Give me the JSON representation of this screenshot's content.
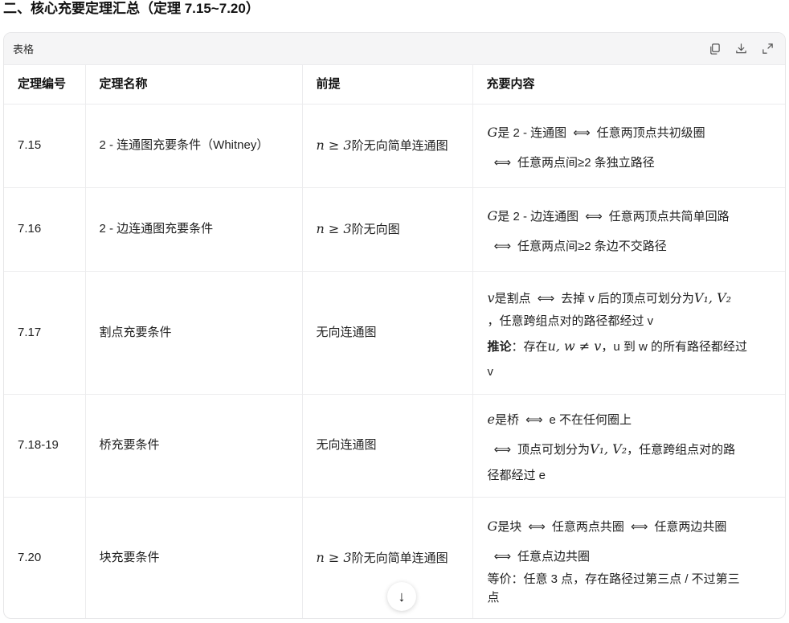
{
  "section_title": "二、核心充要定理汇总（定理 7.15~7.20）",
  "card": {
    "label": "表格",
    "tools": [
      "copy-icon",
      "download-icon",
      "expand-icon"
    ]
  },
  "table": {
    "headers": [
      "定理编号",
      "定理名称",
      "前提",
      "充要内容"
    ],
    "rows": [
      {
        "num": "7.15",
        "name": "2 - 连通图充要条件（Whitney）",
        "premise_math": "n ≥ 3",
        "premise_text": "阶无向简单连通图",
        "c1_math": "G",
        "c1_a": "是 2 - 连通图",
        "c1_b": "任意两顶点共初级圈",
        "c2": "任意两点间≥2 条独立路径"
      },
      {
        "num": "7.16",
        "name": "2 - 边连通图充要条件",
        "premise_math": "n ≥ 3",
        "premise_text": "阶无向图",
        "c1_math": "G",
        "c1_a": "是 2 - 边连通图",
        "c1_b": "任意两顶点共简单回路",
        "c2": "任意两点间≥2 条边不交路径"
      },
      {
        "num": "7.17",
        "name": "割点充要条件",
        "premise_text": "无向连通图",
        "c1_math": "v",
        "c1_a": "是割点",
        "c1_b": "去掉 v 后的顶点可划分为",
        "c1_math2": "V₁, V₂",
        "c2": "，任意跨组点对的路径都经过 v",
        "c3_bold": "推论",
        "c3_a": "：存在",
        "c3_math": "u, w ≠ v",
        "c3_b": "，u 到 w 的所有路径都经过",
        "c3_c": "v"
      },
      {
        "num": "7.18-19",
        "name": "桥充要条件",
        "premise_text": "无向连通图",
        "c1_math": "e",
        "c1_a": "是桥",
        "c1_b": "e 不在任何圈上",
        "c2_a": "顶点可划分为",
        "c2_math": "V₁, V₂",
        "c2_b": "，任意跨组点对的路",
        "c2_c": "径都经过 e"
      },
      {
        "num": "7.20",
        "name": "块充要条件",
        "premise_math": "n ≥ 3",
        "premise_text": "阶无向简单连通图",
        "c1_math": "G",
        "c1_a": "是块",
        "c1_b": "任意两点共圈",
        "c1_c": "任意两边共圈",
        "c2": "任意点边共圈",
        "c3_a": "等价：任意 3 点，存在路径过第三点 / 不过第三",
        "c3_b": "点"
      }
    ]
  },
  "symbols": {
    "iff": "⟺",
    "scroll_down": "↓"
  }
}
